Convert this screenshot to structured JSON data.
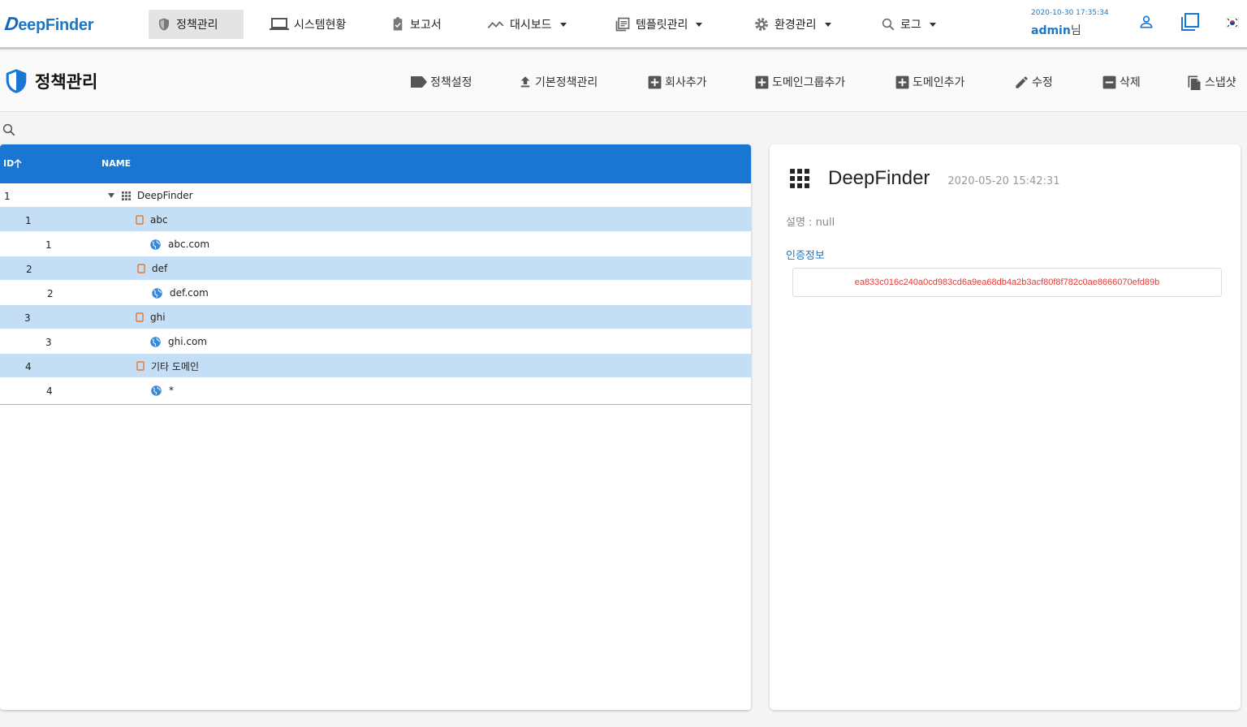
{
  "app": {
    "logo_text": "eepFinder",
    "logo_letter": "D"
  },
  "nav": [
    {
      "label": "정책관리",
      "icon": "shield-icon",
      "active": true
    },
    {
      "label": "시스템현황",
      "icon": "laptop-icon"
    },
    {
      "label": "보고서",
      "icon": "clipboard-check-icon"
    },
    {
      "label": "대시보드",
      "icon": "trending-icon",
      "dropdown": true
    },
    {
      "label": "템플릿관리",
      "icon": "template-icon",
      "dropdown": true
    },
    {
      "label": "환경관리",
      "icon": "gear-icon",
      "dropdown": true
    },
    {
      "label": "로그",
      "icon": "search-icon",
      "dropdown": true
    }
  ],
  "header": {
    "datetime": "2020-10-30 17:35:34",
    "username": "admin",
    "user_suffix": "님"
  },
  "page": {
    "title": "정책관리"
  },
  "toolbar": [
    {
      "label": "정책설정",
      "icon": "label-icon"
    },
    {
      "label": "기본정책관리",
      "icon": "upload-icon"
    },
    {
      "label": "회사추가",
      "icon": "add-box-icon"
    },
    {
      "label": "도메인그룹추가",
      "icon": "add-box-icon"
    },
    {
      "label": "도메인추가",
      "icon": "add-box-icon"
    },
    {
      "label": "수정",
      "icon": "pencil-icon"
    },
    {
      "label": "삭제",
      "icon": "minus-box-icon"
    },
    {
      "label": "스냅샷",
      "icon": "copy-icon"
    }
  ],
  "table": {
    "columns": {
      "id": "ID",
      "name": "NAME"
    },
    "rows": [
      {
        "id": "1",
        "name": "DeepFinder",
        "type": "root"
      },
      {
        "id": "1",
        "name": "abc",
        "type": "company"
      },
      {
        "id": "1",
        "name": "abc.com",
        "type": "domain"
      },
      {
        "id": "2",
        "name": "def",
        "type": "company"
      },
      {
        "id": "2",
        "name": "def.com",
        "type": "domain"
      },
      {
        "id": "3",
        "name": "ghi",
        "type": "company"
      },
      {
        "id": "3",
        "name": "ghi.com",
        "type": "domain"
      },
      {
        "id": "4",
        "name": "기타 도메인",
        "type": "company"
      },
      {
        "id": "4",
        "name": "*",
        "type": "domain"
      }
    ]
  },
  "detail": {
    "name": "DeepFinder",
    "date": "2020-05-20 15:42:31",
    "description": "설명 : null",
    "auth_label": "인증정보",
    "auth_value": "ea833c016c240a0cd983cd6a9ea68db4a2b3acf80f8f782c0ae8666070efd89b"
  },
  "colors": {
    "primary": "#1976d2",
    "row_highlight": "#c4dff5",
    "company_icon": "#e8772e",
    "auth_text": "#e53935"
  }
}
